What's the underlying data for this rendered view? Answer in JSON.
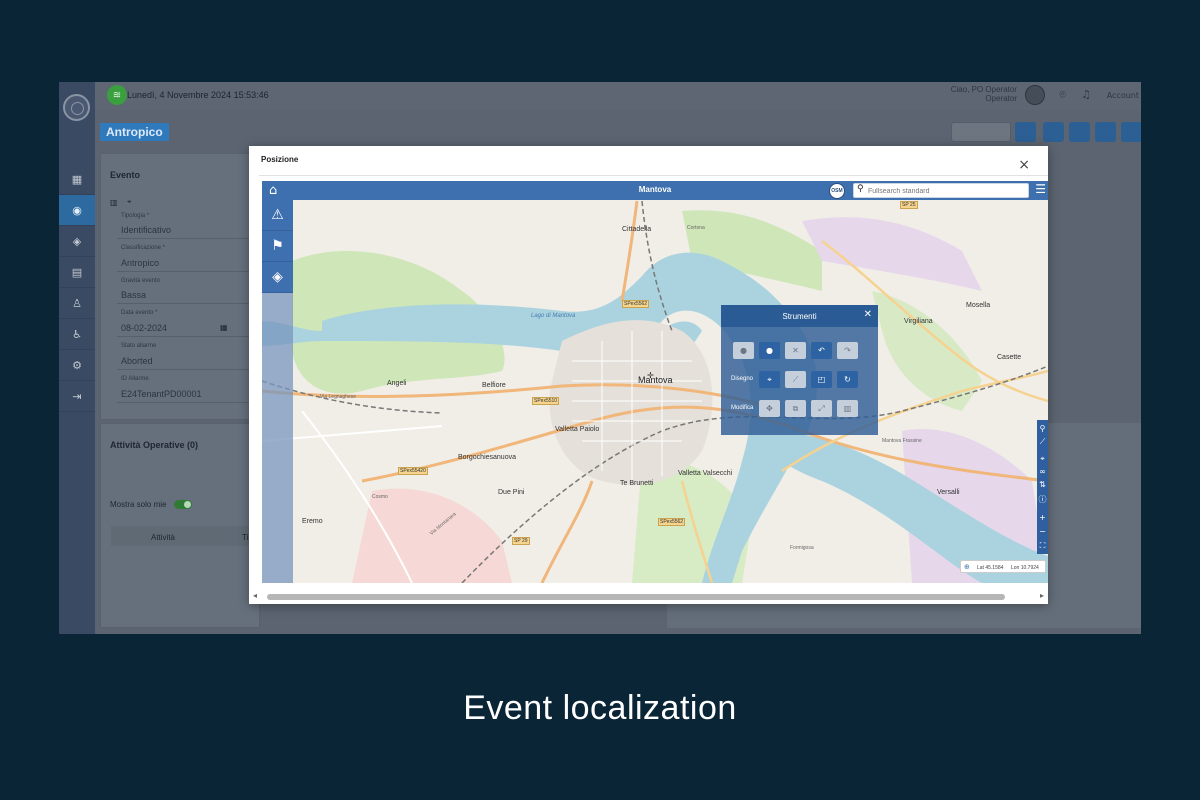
{
  "header": {
    "datetime": "Lunedì, 4 Novembre 2024 15:53:46",
    "user_line1": "Ciao, PO Operator",
    "user_line2": "Operator",
    "user_short": "Account"
  },
  "context_pill": "Antropico",
  "sidebar_icons": [
    "dashboard-icon",
    "events-icon",
    "layers-icon",
    "calendar-icon",
    "users-icon",
    "activity-icon",
    "settings-icon",
    "exit-icon"
  ],
  "event_panel": {
    "title": "Evento",
    "fields": [
      {
        "label": "Tipologia *",
        "value": "Identificativo"
      },
      {
        "label": "Classificazione *",
        "value": "Antropico"
      },
      {
        "label": "Gravità evento",
        "value": "Bassa"
      },
      {
        "label": "Data evento *",
        "value": "08-02-2024"
      },
      {
        "label": "Stato allarme",
        "value": "Aborted"
      },
      {
        "label": "ID Allarme",
        "value": "E24TenantPD00001"
      }
    ]
  },
  "activities_panel": {
    "title": "Attività Operative (0)",
    "toggle_label": "Mostra solo mie",
    "column_1": "Attività",
    "column_2": "Ti"
  },
  "modal": {
    "title": "Posizione",
    "close_glyph": "×"
  },
  "map": {
    "title": "Mantova",
    "osm_badge": "OSM",
    "search_placeholder": "Fullsearch standard",
    "left_buttons": [
      "alert-icon",
      "flag-icon",
      "layers-icon"
    ],
    "places": {
      "mantova": "Mantova",
      "cittadella": "Cittadella",
      "belfiore": "Belfiore",
      "valletta_paiolo": "Valletta Paiolo",
      "borgochiesanuova": "Borgochiesanuova",
      "due_pini": "Due Pini",
      "te_brunetti": "Te Brunetti",
      "valletta_valsecchi": "Valletta Valsecchi",
      "lago_mantova": "Lago di Mantova",
      "angeli": "Angeli",
      "formigosa": "Formigosa",
      "virgiliana": "Virgiliana",
      "casette": "Casette",
      "versalli": "Versalli",
      "mosella": "Mosella",
      "cortona": "Cortona",
      "mantova_frassine": "Mantova Frassine",
      "eremo": "Eremo",
      "cosmo": "Cosmo",
      "via_montanara": "Via Montanara",
      "via_legnaghese": "Via Legnaghese"
    },
    "roads": {
      "spex5562_top": "SPex5562",
      "spex5510": "SPex5510",
      "spex55420": "SPex55420",
      "spex5562_bottom": "SPex5562",
      "sp29": "SP 29",
      "sp25": "SP 25"
    }
  },
  "tools": {
    "title": "Strumenti",
    "row_draw_label": "Disegno",
    "row_edit_label": "Modifica",
    "row1": [
      {
        "name": "stop-tool-icon",
        "glyph": "●",
        "active": false
      },
      {
        "name": "record-tool-icon",
        "glyph": "●",
        "active": true
      },
      {
        "name": "cancel-tool-icon",
        "glyph": "✕",
        "active": false
      },
      {
        "name": "undo-tool-icon",
        "glyph": "↶",
        "active": true
      },
      {
        "name": "redo-tool-icon",
        "glyph": "↷",
        "active": false
      }
    ],
    "row2": [
      {
        "name": "point-tool-icon",
        "glyph": "⌖",
        "active": true
      },
      {
        "name": "line-tool-icon",
        "glyph": "⟋",
        "active": false
      },
      {
        "name": "polygon-tool-icon",
        "glyph": "◰",
        "active": true
      },
      {
        "name": "circle-tool-icon",
        "glyph": "↻",
        "active": true
      }
    ],
    "row3": [
      {
        "name": "move-tool-icon",
        "glyph": "✥",
        "active": false
      },
      {
        "name": "copy-tool-icon",
        "glyph": "⧉",
        "active": false
      },
      {
        "name": "scale-tool-icon",
        "glyph": "⤢",
        "active": false
      },
      {
        "name": "delete-tool-icon",
        "glyph": "▥",
        "active": false
      }
    ]
  },
  "map_right_tools": [
    "marker-icon",
    "measure-icon",
    "locate-icon",
    "binoculars-icon",
    "route-icon",
    "info-icon",
    "zoom-in-icon",
    "zoom-out-icon",
    "fullscreen-icon"
  ],
  "coords": {
    "lat_label": "Lat",
    "lat": "45.1584",
    "lon_label": "Lon",
    "lon": "10.7924"
  },
  "caption": "Event localization"
}
